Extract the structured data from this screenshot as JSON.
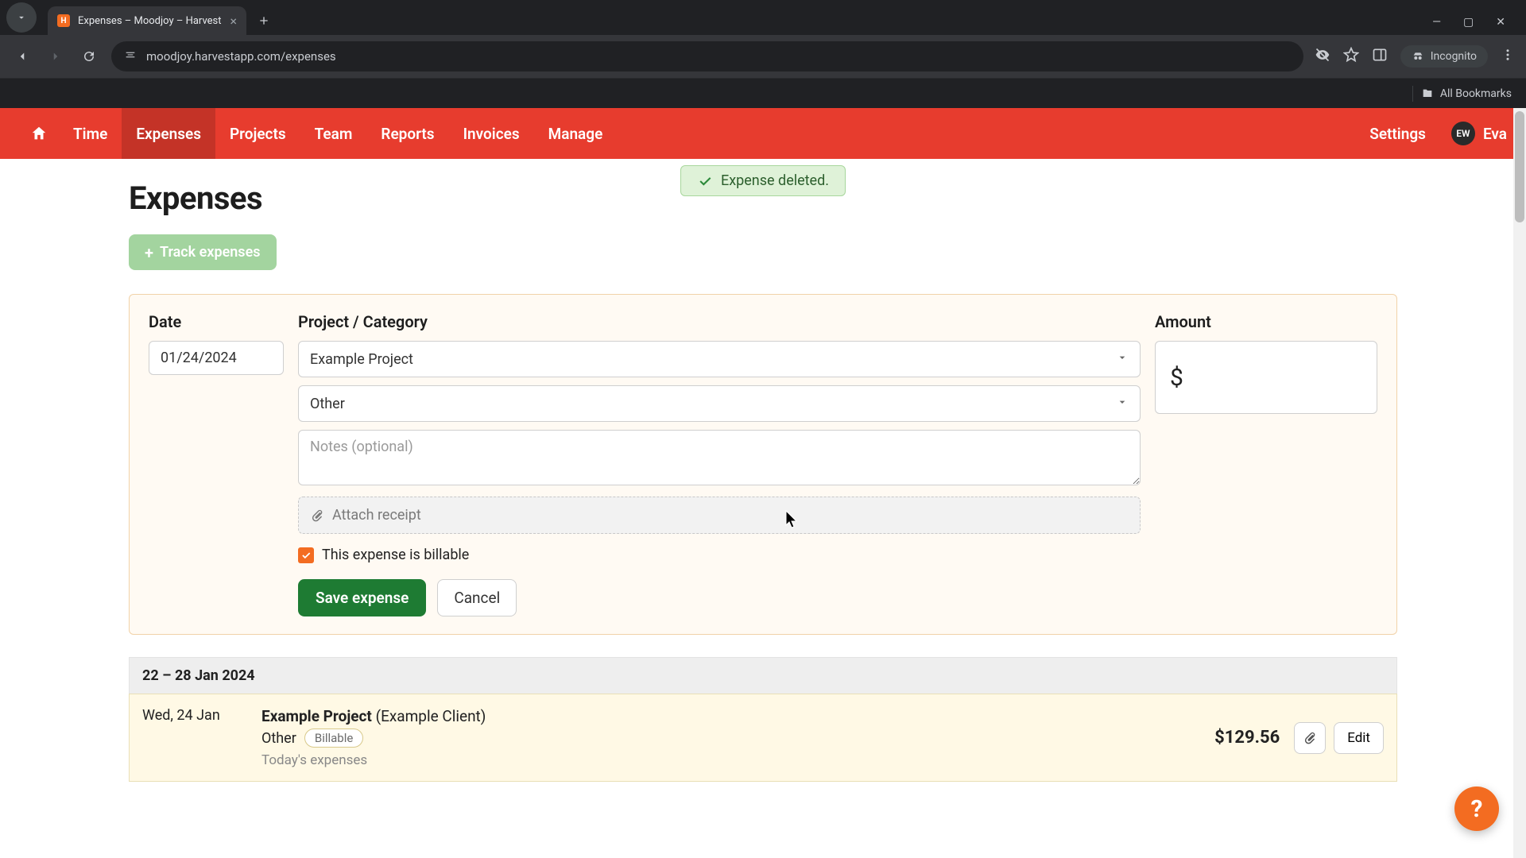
{
  "browser": {
    "tab_title": "Expenses – Moodjoy – Harvest",
    "url": "moodjoy.harvestapp.com/expenses",
    "incognito_label": "Incognito",
    "all_bookmarks": "All Bookmarks"
  },
  "nav": {
    "items": [
      "Time",
      "Expenses",
      "Projects",
      "Team",
      "Reports",
      "Invoices",
      "Manage"
    ],
    "active_index": 1,
    "settings": "Settings",
    "user_initials": "EW",
    "user_name": "Eva"
  },
  "toast": {
    "text": "Expense deleted."
  },
  "page": {
    "title": "Expenses",
    "track_button": "Track expenses"
  },
  "form": {
    "labels": {
      "date": "Date",
      "project_category": "Project / Category",
      "amount": "Amount"
    },
    "date_value": "01/24/2024",
    "project_value": "Example Project",
    "category_value": "Other",
    "notes_placeholder": "Notes (optional)",
    "attach_label": "Attach receipt",
    "currency_symbol": "$",
    "billable_label": "This expense is billable",
    "billable_checked": true,
    "save_label": "Save expense",
    "cancel_label": "Cancel"
  },
  "list": {
    "range_heading": "22 – 28 Jan 2024",
    "rows": [
      {
        "day": "Wed, 24 Jan",
        "project": "Example Project",
        "client": "(Example Client)",
        "category": "Other",
        "badge": "Billable",
        "note": "Today's expenses",
        "amount": "$129.56",
        "edit_label": "Edit"
      }
    ]
  },
  "help": {
    "label": "?"
  }
}
